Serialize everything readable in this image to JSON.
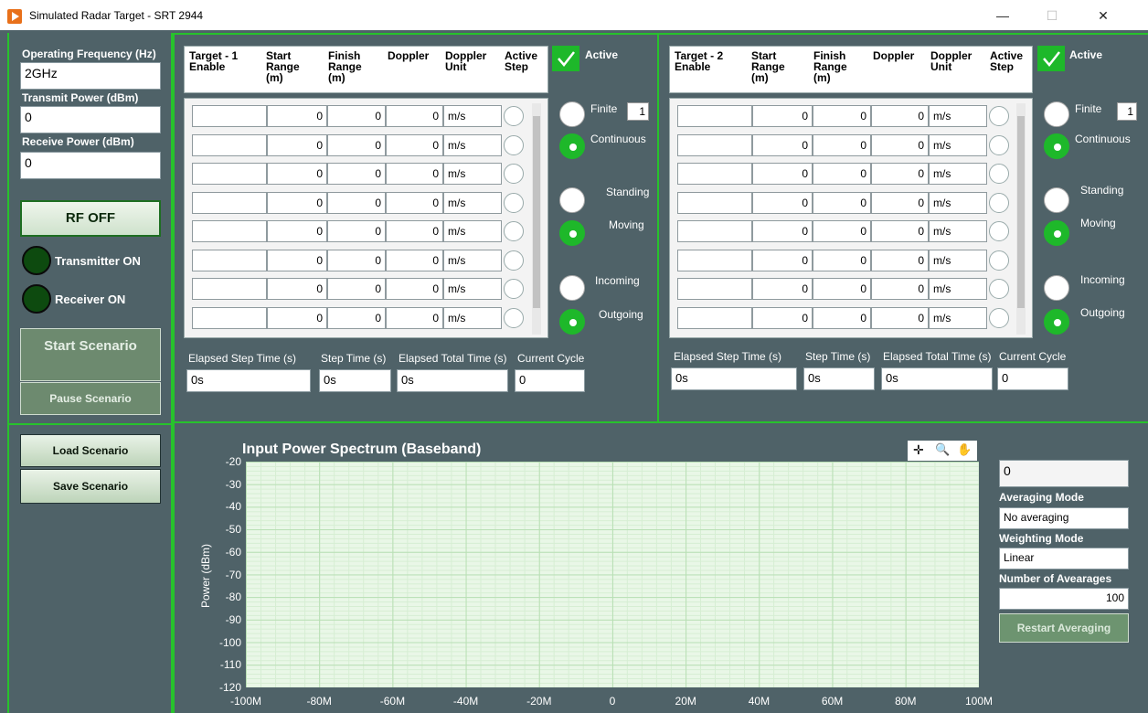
{
  "window": {
    "title": "Simulated Radar Target - SRT 2944",
    "minimize": "—",
    "maximize": "☐",
    "close": "✕"
  },
  "left": {
    "freq_label": "Operating Frequency (Hz)",
    "freq_value": "2GHz",
    "tx_label": "Transmit Power (dBm)",
    "tx_value": "0",
    "rx_label": "Receive Power (dBm)",
    "rx_value": "0",
    "rf_button": "RF OFF",
    "transmitter": "Transmitter ON",
    "receiver": "Receiver ON",
    "start": "Start Scenario",
    "pause": "Pause Scenario",
    "load": "Load Scenario",
    "save": "Save Scenario"
  },
  "targets": [
    {
      "headers": [
        "Target - 1 Enable",
        "Start Range (m)",
        "Finish Range (m)",
        "Doppler",
        "Doppler Unit",
        "Active Step"
      ],
      "active": "Active",
      "finite": "Finite",
      "finite_count": "1",
      "continuous": "Continuous",
      "standing": "Standing",
      "moving": "Moving",
      "incoming": "Incoming",
      "outgoing": "Outgoing",
      "rows": [
        {
          "start": "0",
          "finish": "0",
          "doppler": "0",
          "unit": "m/s"
        },
        {
          "start": "0",
          "finish": "0",
          "doppler": "0",
          "unit": "m/s"
        },
        {
          "start": "0",
          "finish": "0",
          "doppler": "0",
          "unit": "m/s"
        },
        {
          "start": "0",
          "finish": "0",
          "doppler": "0",
          "unit": "m/s"
        },
        {
          "start": "0",
          "finish": "0",
          "doppler": "0",
          "unit": "m/s"
        },
        {
          "start": "0",
          "finish": "0",
          "doppler": "0",
          "unit": "m/s"
        },
        {
          "start": "0",
          "finish": "0",
          "doppler": "0",
          "unit": "m/s"
        },
        {
          "start": "0",
          "finish": "0",
          "doppler": "0",
          "unit": "m/s"
        }
      ],
      "elapsed_step_label": "Elapsed Step Time (s)",
      "elapsed_step": "0s",
      "step_label": "Step Time (s)",
      "step": "0s",
      "elapsed_total_label": "Elapsed Total Time (s)",
      "elapsed_total": "0s",
      "cycle_label": "Current Cycle",
      "cycle": "0"
    },
    {
      "headers": [
        "Target - 2 Enable",
        "Start Range (m)",
        "Finish Range (m)",
        "Doppler",
        "Doppler Unit",
        "Active Step"
      ],
      "active": "Active",
      "finite": "Finite",
      "finite_count": "1",
      "continuous": "Continuous",
      "standing": "Standing",
      "moving": "Moving",
      "incoming": "Incoming",
      "outgoing": "Outgoing",
      "rows": [
        {
          "start": "0",
          "finish": "0",
          "doppler": "0",
          "unit": "m/s"
        },
        {
          "start": "0",
          "finish": "0",
          "doppler": "0",
          "unit": "m/s"
        },
        {
          "start": "0",
          "finish": "0",
          "doppler": "0",
          "unit": "m/s"
        },
        {
          "start": "0",
          "finish": "0",
          "doppler": "0",
          "unit": "m/s"
        },
        {
          "start": "0",
          "finish": "0",
          "doppler": "0",
          "unit": "m/s"
        },
        {
          "start": "0",
          "finish": "0",
          "doppler": "0",
          "unit": "m/s"
        },
        {
          "start": "0",
          "finish": "0",
          "doppler": "0",
          "unit": "m/s"
        },
        {
          "start": "0",
          "finish": "0",
          "doppler": "0",
          "unit": "m/s"
        }
      ],
      "elapsed_step_label": "Elapsed Step Time (s)",
      "elapsed_step": "0s",
      "step_label": "Step Time (s)",
      "step": "0s",
      "elapsed_total_label": "Elapsed Total Time (s)",
      "elapsed_total": "0s",
      "cycle_label": "Current Cycle",
      "cycle": "0"
    }
  ],
  "spectrum": {
    "title": "Input Power Spectrum (Baseband)",
    "ylabel": "Power (dBm)",
    "y_ticks": [
      "-20",
      "-30",
      "-40",
      "-50",
      "-60",
      "-70",
      "-80",
      "-90",
      "-100",
      "-110",
      "-120"
    ],
    "x_ticks": [
      "-100M",
      "-80M",
      "-60M",
      "-40M",
      "-20M",
      "0",
      "20M",
      "40M",
      "60M",
      "80M",
      "100M"
    ],
    "tools": [
      "cursor-icon",
      "zoom-icon",
      "pan-icon"
    ],
    "value_top": "0",
    "avg_mode_label": "Averaging Mode",
    "avg_mode": "No averaging",
    "weight_label": "Weighting Mode",
    "weight": "Linear",
    "num_label": "Number of Avearages",
    "num": "100",
    "restart": "Restart Averaging"
  },
  "colors": {
    "background": "#4f6268",
    "border": "#27c22c",
    "accent": "#1eb82a"
  }
}
